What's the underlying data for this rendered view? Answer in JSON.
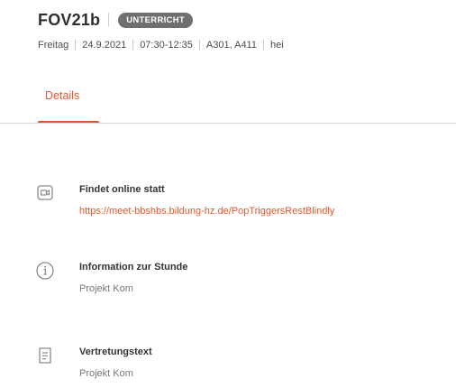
{
  "header": {
    "title": "FOV21b",
    "badge": "UNTERRICHT",
    "meta": {
      "day": "Freitag",
      "date": "24.9.2021",
      "time": "07:30-12:35",
      "rooms": "A301, A411",
      "teacher": "hei"
    }
  },
  "tabs": [
    {
      "label": "Details",
      "active": true
    }
  ],
  "sections": [
    {
      "title": "Findet online statt",
      "value": "https://meet-bbshbs.bildung-hz.de/PopTriggersRestBlindly",
      "icon": "video-icon"
    },
    {
      "title": "Information zur Stunde",
      "value": "Projekt Kom",
      "icon": "info-icon"
    },
    {
      "title": "Vertretungstext",
      "value": "Projekt Kom",
      "icon": "document-icon"
    }
  ],
  "colors": {
    "accent": "#e8542a",
    "badge_bg": "#6f6f6f",
    "text": "#333333",
    "muted": "#777777"
  }
}
